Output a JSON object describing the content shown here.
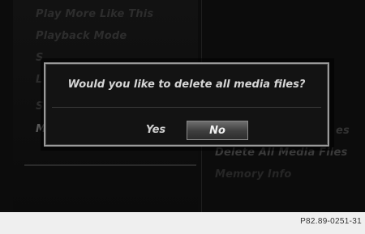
{
  "menu": {
    "left_items": [
      "Play More Like This",
      "Playback Mode",
      "S",
      "L",
      "S",
      "M"
    ],
    "right_items": [
      "es",
      "Delete All Media Files",
      "Memory Info"
    ]
  },
  "dialog": {
    "message": "Would you like to delete all media files?",
    "yes_label": "Yes",
    "no_label": "No",
    "selected": "No"
  },
  "footer": {
    "figure_code": "P82.89-0251-31"
  }
}
